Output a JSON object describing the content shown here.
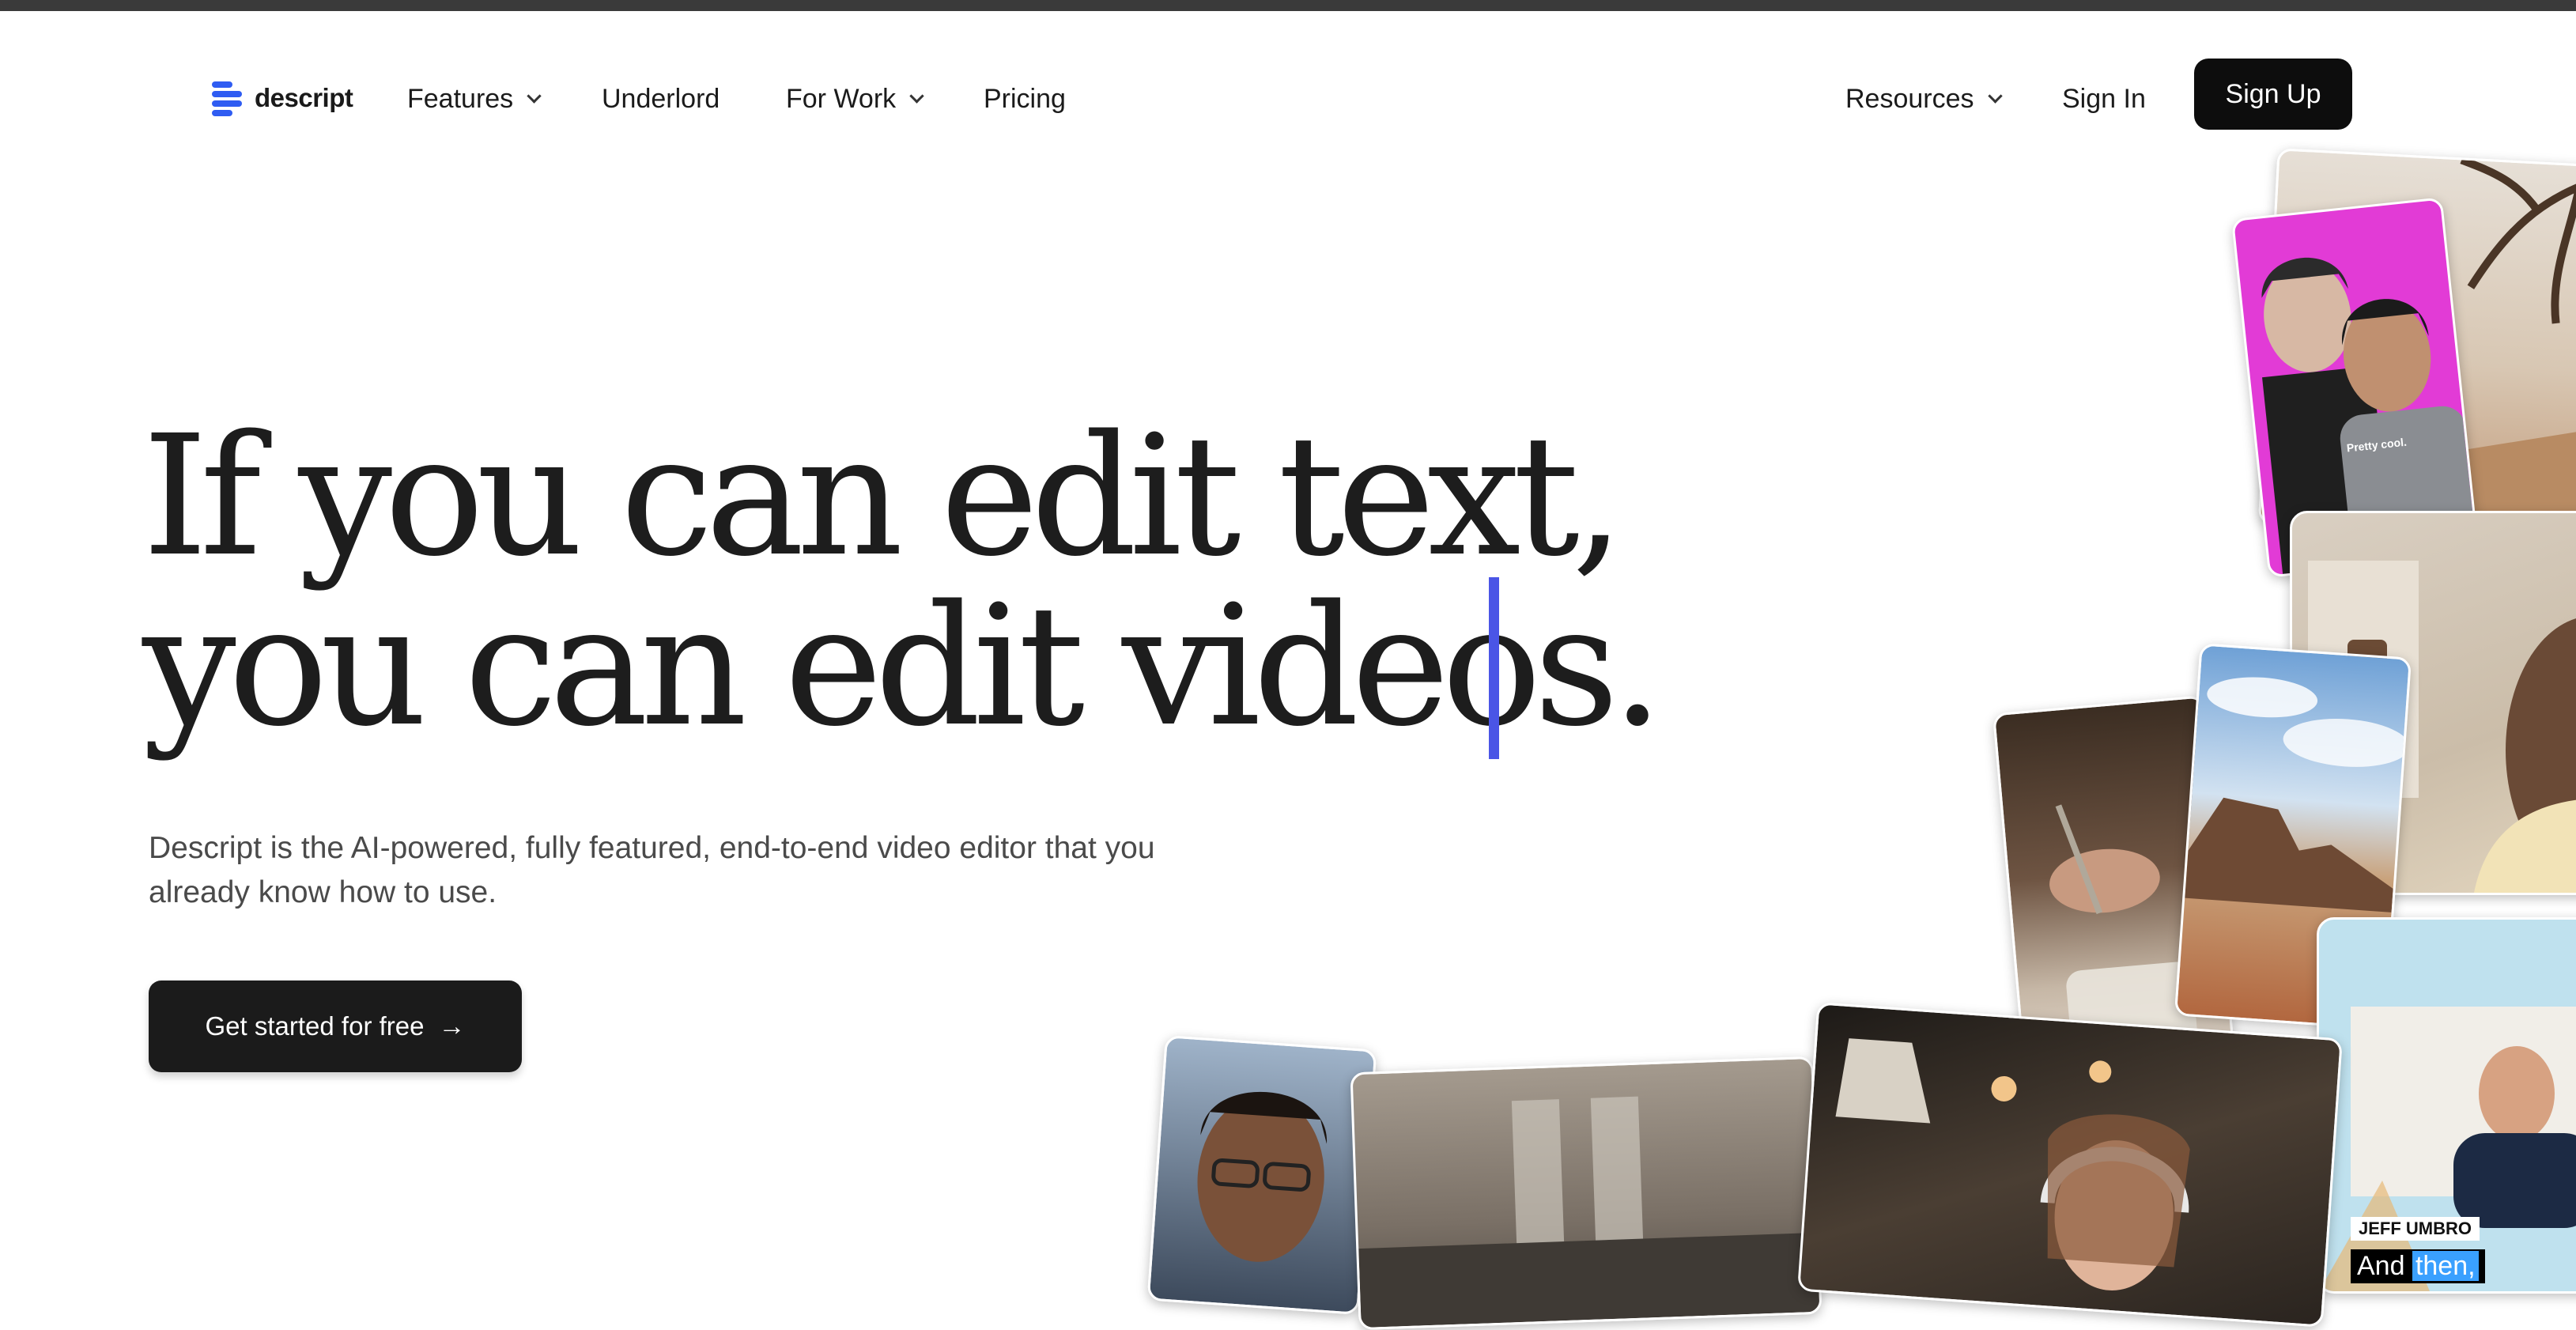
{
  "nav": {
    "logo_text": "descript",
    "items": [
      {
        "label": "Features"
      },
      {
        "label": "Underlord"
      },
      {
        "label": "For Work"
      },
      {
        "label": "Pricing"
      }
    ],
    "resources": "Resources",
    "sign_in": "Sign In",
    "sign_up": "Sign Up"
  },
  "hero": {
    "headline_line1": "If you can edit text,",
    "headline_line2": "you can edit videos.",
    "subcopy": "Descript is the AI-powered, fully featured, end-to-end video editor that you already know how to use.",
    "cta_label": "Get started for free",
    "cta_icon": "arrow-right-icon"
  },
  "collage": {
    "selfie_caption": "Pretty cool.",
    "speaker_name": "JEFF UMBRO",
    "subtitle_word_1": "And",
    "subtitle_word_2": "then,"
  },
  "colors": {
    "brand_blue": "#2f5cf2",
    "caret": "#4a55e6",
    "button_dark": "#0d0d0d"
  }
}
